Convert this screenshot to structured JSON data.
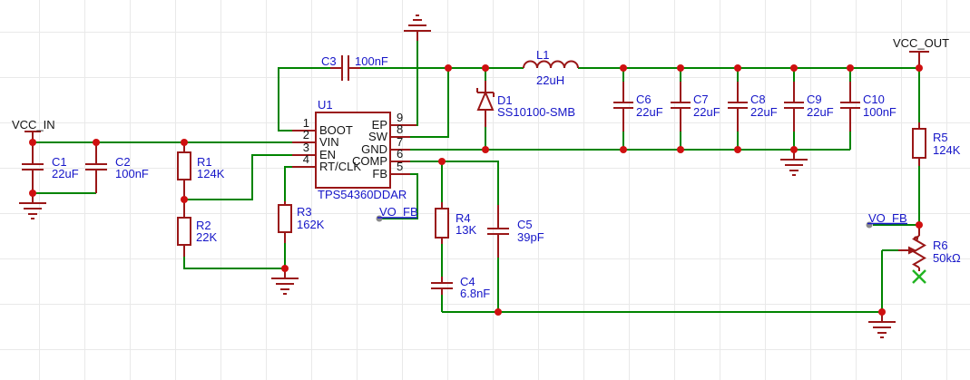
{
  "app": {
    "view": "schematic-canvas"
  },
  "nets": {
    "vcc_in": "VCC_IN",
    "vcc_out": "VCC_OUT",
    "vo_fb_left": "VO_FB",
    "vo_fb_right": "VO_FB"
  },
  "ic": {
    "ref": "U1",
    "part": "TPS54360DDAR",
    "left_pins": [
      {
        "num": "1",
        "name": "BOOT"
      },
      {
        "num": "2",
        "name": "VIN"
      },
      {
        "num": "3",
        "name": "EN"
      },
      {
        "num": "4",
        "name": "RT/CLK"
      }
    ],
    "right_pins": [
      {
        "num": "9",
        "name": "EP"
      },
      {
        "num": "8",
        "name": "SW"
      },
      {
        "num": "7",
        "name": "GND"
      },
      {
        "num": "6",
        "name": "COMP"
      },
      {
        "num": "5",
        "name": "FB"
      }
    ]
  },
  "components": {
    "c1": {
      "ref": "C1",
      "value": "22uF"
    },
    "c2": {
      "ref": "C2",
      "value": "100nF"
    },
    "c3": {
      "ref": "C3",
      "value": "100nF"
    },
    "c4": {
      "ref": "C4",
      "value": "6.8nF"
    },
    "c5": {
      "ref": "C5",
      "value": "39pF"
    },
    "c6": {
      "ref": "C6",
      "value": "22uF"
    },
    "c7": {
      "ref": "C7",
      "value": "22uF"
    },
    "c8": {
      "ref": "C8",
      "value": "22uF"
    },
    "c9": {
      "ref": "C9",
      "value": "22uF"
    },
    "c10": {
      "ref": "C10",
      "value": "100nF"
    },
    "r1": {
      "ref": "R1",
      "value": "124K"
    },
    "r2": {
      "ref": "R2",
      "value": "22K"
    },
    "r3": {
      "ref": "R3",
      "value": "162K"
    },
    "r4": {
      "ref": "R4",
      "value": "13K"
    },
    "r5": {
      "ref": "R5",
      "value": "124K"
    },
    "r6": {
      "ref": "R6",
      "value": "50kΩ"
    },
    "d1": {
      "ref": "D1",
      "value": "SS10100-SMB"
    },
    "l1": {
      "ref": "L1",
      "value": "22uH"
    }
  },
  "colors": {
    "wire": "#008400",
    "component": "#9a1717",
    "junction": "#cf1010",
    "label_blue": "#1616c8",
    "net_label": "#141414",
    "no_connect": "#22b422",
    "port": "#8a8a8a",
    "grid": "#e9e9e9",
    "background": "#ffffff"
  }
}
